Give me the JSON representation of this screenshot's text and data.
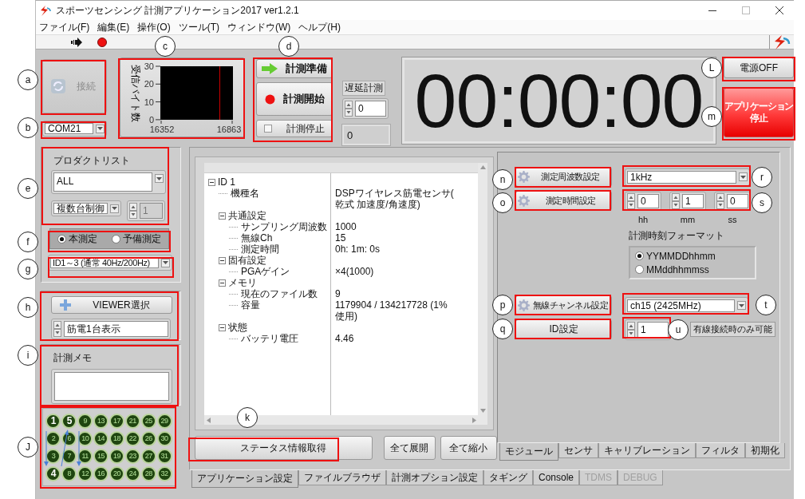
{
  "window": {
    "title": "スポーツセンシング 計測アプリケーション2017 ver1.2.1"
  },
  "menu": [
    "ファイル(F)",
    "編集(E)",
    "操作(O)",
    "ツール(T)",
    "ウィンドウ(W)",
    "ヘルプ(H)"
  ],
  "connect_button": {
    "label": "接続",
    "disabled": true
  },
  "port_combo": {
    "value": "COM21"
  },
  "byte_chart": {
    "ylabel": "受信バイト数",
    "yticks": [
      "30",
      "20",
      "10",
      "0"
    ],
    "xticks": [
      "16352",
      "16863"
    ]
  },
  "measure_buttons": [
    {
      "kind": "arrow",
      "label": "計測準備"
    },
    {
      "kind": "record",
      "label": "計測開始"
    },
    {
      "kind": "checkbox",
      "label": "計測停止",
      "checked": false
    }
  ],
  "delay": {
    "label": "遅延計測",
    "value": "0",
    "readout": "0"
  },
  "timer": "00:00:00",
  "power_button": "電源OFF",
  "stop_button": {
    "lines": [
      "アプリケーション",
      "停止"
    ]
  },
  "product_list": {
    "label": "プロダクトリスト",
    "value": "ALL"
  },
  "control_combo": {
    "value": "複数台制御"
  },
  "count_spinner": {
    "value": "1",
    "disabled": true
  },
  "measure_mode": [
    {
      "label": "本測定",
      "selected": true
    },
    {
      "label": "予備測定",
      "selected": false
    }
  ],
  "rate_combo": {
    "value": "ID1～3 (通常 40Hz/200Hz)"
  },
  "viewer": {
    "button": "VIEWER選択",
    "spinner": "筋電1台表示"
  },
  "memo": {
    "label": "計測メモ"
  },
  "led_grid": {
    "rows": [
      [
        {
          "number": "1",
          "highlighted": true
        },
        {
          "number": "5",
          "highlighted": true
        },
        {
          "number": "9",
          "highlighted": false
        },
        {
          "number": "13",
          "highlighted": false
        },
        {
          "number": "17",
          "highlighted": false
        },
        {
          "number": "21",
          "highlighted": false
        },
        {
          "number": "25",
          "highlighted": false
        },
        {
          "number": "29",
          "highlighted": false
        }
      ],
      [
        {
          "number": "2",
          "highlighted": false
        },
        {
          "number": "6",
          "highlighted": false
        },
        {
          "number": "10",
          "highlighted": false
        },
        {
          "number": "14",
          "highlighted": false
        },
        {
          "number": "18",
          "highlighted": false
        },
        {
          "number": "22",
          "highlighted": false
        },
        {
          "number": "26",
          "highlighted": false
        },
        {
          "number": "30",
          "highlighted": false
        }
      ],
      [
        {
          "number": "3",
          "highlighted": false
        },
        {
          "number": "7",
          "highlighted": false
        },
        {
          "number": "11",
          "highlighted": false
        },
        {
          "number": "15",
          "highlighted": false
        },
        {
          "number": "19",
          "highlighted": false
        },
        {
          "number": "23",
          "highlighted": false
        },
        {
          "number": "27",
          "highlighted": false
        },
        {
          "number": "31",
          "highlighted": false
        }
      ],
      [
        {
          "number": "4",
          "highlighted": true
        },
        {
          "number": "8",
          "highlighted": false
        },
        {
          "number": "12",
          "highlighted": false
        },
        {
          "number": "16",
          "highlighted": false
        },
        {
          "number": "20",
          "highlighted": false
        },
        {
          "number": "24",
          "highlighted": false
        },
        {
          "number": "28",
          "highlighted": false
        },
        {
          "number": "32",
          "highlighted": false
        }
      ]
    ]
  },
  "tree": {
    "nodes": [
      {
        "label": "ID 1",
        "expanded": true,
        "children": [
          {
            "label": "機種名",
            "value": "DSPワイヤレス筋電センサ(乾式 加速度/角速度)"
          },
          {
            "label": "共通設定",
            "expanded": true,
            "children": [
              {
                "label": "サンプリング周波数",
                "value": "1000"
              },
              {
                "label": "無線Ch",
                "value": "15"
              },
              {
                "label": "測定時間",
                "value": "0h: 1m: 0s"
              }
            ]
          },
          {
            "label": "固有設定",
            "expanded": true,
            "children": [
              {
                "label": "PGAゲイン",
                "value": "×4(1000)"
              }
            ]
          },
          {
            "label": "メモリ",
            "expanded": true,
            "children": [
              {
                "label": "現在のファイル数",
                "value": "9"
              },
              {
                "label": "容量",
                "value": "1179904 / 134217728 (1%使用)"
              }
            ]
          },
          {
            "label": "状態",
            "expanded": true,
            "children": [
              {
                "label": "バッテリ電圧",
                "value": "4.46"
              }
            ]
          }
        ]
      }
    ]
  },
  "tree_buttons": [
    "ステータス情報取得",
    "全て展開",
    "全て縮小"
  ],
  "main_tabs": [
    {
      "label": "アプリケーション設定",
      "selected": true,
      "disabled": false
    },
    {
      "label": "ファイルブラウザ",
      "selected": false,
      "disabled": false
    },
    {
      "label": "計測オプション設定",
      "selected": false,
      "disabled": false
    },
    {
      "label": "タギング",
      "selected": false,
      "disabled": false
    },
    {
      "label": "Console",
      "selected": false,
      "disabled": false
    },
    {
      "label": "TDMS",
      "selected": false,
      "disabled": true
    },
    {
      "label": "DEBUG",
      "selected": false,
      "disabled": true
    }
  ],
  "module_panel": {
    "freq_button": {
      "label": "測定周波数設定",
      "kind": "gear"
    },
    "freq_combo": "1kHz",
    "time_button": {
      "label": "測定時間設定",
      "kind": "gear"
    },
    "time_spinners": [
      {
        "value": "0",
        "unit": "hh"
      },
      {
        "value": "1",
        "unit": "mm"
      },
      {
        "value": "0",
        "unit": "ss"
      }
    ],
    "format": {
      "label": "計測時刻フォーマット",
      "options": [
        {
          "label": "YYMMDDhhmm",
          "selected": true
        },
        {
          "label": "MMddhhmmss",
          "selected": false
        }
      ]
    },
    "channel_button": {
      "label": "無線チャンネル設定",
      "kind": "gear"
    },
    "channel_combo": "ch15 (2425MHz)",
    "id_button": {
      "label": "ID設定",
      "kind": "plain"
    },
    "id_spinner": "1",
    "id_note": "有線接続時のみ可能"
  },
  "sub_tabs": [
    {
      "label": "モジュール",
      "selected": true
    },
    {
      "label": "センサ",
      "selected": false
    },
    {
      "label": "キャリブレーション",
      "selected": false
    },
    {
      "label": "フィルタ",
      "selected": false
    },
    {
      "label": "初期化",
      "selected": false
    }
  ],
  "callouts": [
    {
      "label": "a"
    },
    {
      "label": "b"
    },
    {
      "label": "c"
    },
    {
      "label": "d"
    },
    {
      "label": "e"
    },
    {
      "label": "f"
    },
    {
      "label": "g"
    },
    {
      "label": "h"
    },
    {
      "label": "i"
    },
    {
      "label": "J"
    },
    {
      "label": "k"
    },
    {
      "label": "L"
    },
    {
      "label": "m"
    },
    {
      "label": "n"
    },
    {
      "label": "o"
    },
    {
      "label": "p"
    },
    {
      "label": "q"
    },
    {
      "label": "r"
    },
    {
      "label": "s"
    },
    {
      "label": "t"
    },
    {
      "label": "u"
    }
  ]
}
